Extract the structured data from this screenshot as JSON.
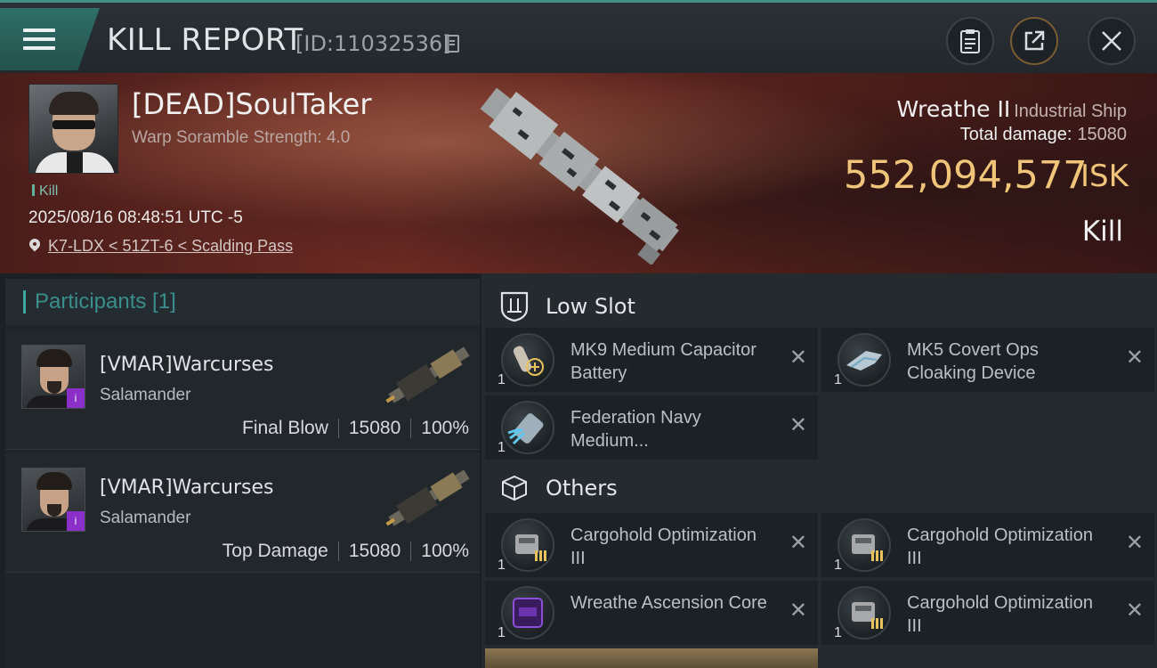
{
  "header": {
    "title": "KILL REPORT",
    "report_id": "[ID:11032536]",
    "icons": [
      "menu-icon",
      "copy-icon",
      "clipboard-icon",
      "share-icon",
      "close-icon"
    ]
  },
  "victim": {
    "name": "[DEAD]SoulTaker",
    "subtitle": "Warp Soramble Strength: 4.0",
    "tag": "Kill",
    "datetime": "2025/08/16 08:48:51 UTC -5",
    "location": "K7-LDX < 51ZT-6 < Scalding Pass"
  },
  "ship": {
    "name": "Wreathe II",
    "class": "Industrial Ship",
    "total_damage_label": "Total damage:",
    "total_damage": "15080",
    "isk_value": "552,094,577",
    "isk_unit": "ISK",
    "result": "Kill"
  },
  "participants": {
    "label": "Participants [1]",
    "items": [
      {
        "name": "[VMAR]Warcurses",
        "ship": "Salamander",
        "role": "Final Blow",
        "damage": "15080",
        "percent": "100%"
      },
      {
        "name": "[VMAR]Warcurses",
        "ship": "Salamander",
        "role": "Top Damage",
        "damage": "15080",
        "percent": "100%"
      }
    ]
  },
  "low_slot": {
    "label": "Low Slot",
    "items": [
      {
        "name": "MK9 Medium Capacitor Battery",
        "qty": "1"
      },
      {
        "name": "MK5 Covert Ops Cloaking Device",
        "qty": "1"
      },
      {
        "name": "Federation Navy Medium...",
        "qty": "1"
      }
    ]
  },
  "others": {
    "label": "Others",
    "items": [
      {
        "name": "Cargohold Optimization III",
        "qty": "1"
      },
      {
        "name": "Cargohold Optimization III",
        "qty": "1"
      },
      {
        "name": "Wreathe Ascension Core",
        "qty": "1"
      },
      {
        "name": "Cargohold Optimization III",
        "qty": "1"
      }
    ]
  },
  "remove_glyph": "✕",
  "colors": {
    "accent": "#3fa6a0",
    "isk": "#f0c479",
    "hero": "#6b2a22"
  }
}
